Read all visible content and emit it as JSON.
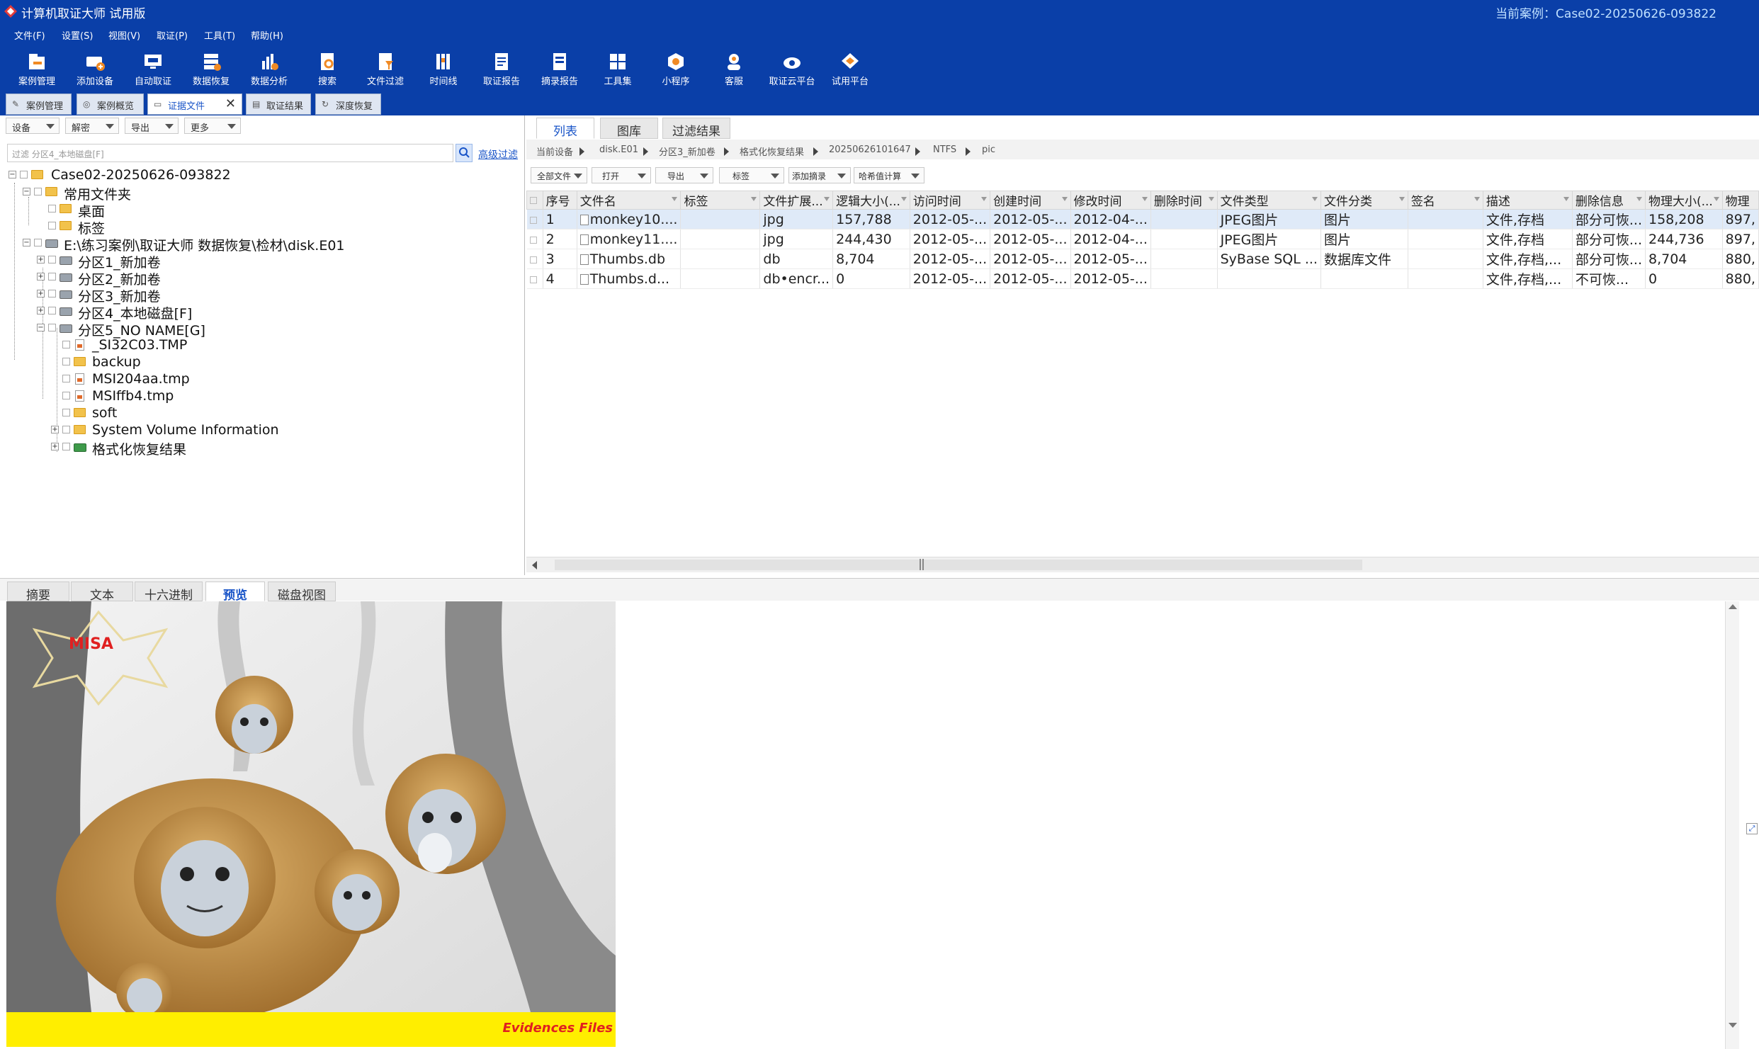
{
  "titlebar": {
    "app_title": "计算机取证大师 试用版",
    "current_case": "当前案例：Case02-20250626-093822"
  },
  "menu": [
    "文件(F)",
    "设置(S)",
    "视图(V)",
    "取证(P)",
    "工具(T)",
    "帮助(H)"
  ],
  "toolbar": [
    "案例管理",
    "添加设备",
    "自动取证",
    "数据恢复",
    "数据分析",
    "搜索",
    "文件过滤",
    "时间线",
    "取证报告",
    "摘录报告",
    "工具集",
    "小程序",
    "客服",
    "取证云平台",
    "试用平台"
  ],
  "doc_tabs": [
    "案例管理",
    "案例概览",
    "证据文件",
    "取证结果",
    "深度恢复"
  ],
  "left": {
    "buttons": [
      "设备",
      "解密",
      "导出",
      "更多"
    ],
    "filter_placeholder": "过滤 分区4_本地磁盘[F]",
    "advanced_filter": "高级过滤",
    "tree": {
      "case": "Case02-20250626-093822",
      "common": "常用文件夹",
      "desktop": "桌面",
      "tags": "标签",
      "evidence": "E:\\练习案例\\取证大师 数据恢复\\检材\\disk.E01",
      "p1": "分区1_新加卷",
      "p2": "分区2_新加卷",
      "p3": "分区3_新加卷",
      "p4": "分区4_本地磁盘[F]",
      "p5": "分区5_NO NAME[G]",
      "f1": "_SI32C03.TMP",
      "f2": "backup",
      "f3": "MSI204aa.tmp",
      "f4": "MSIffb4.tmp",
      "f5": "soft",
      "f6": "System Volume Information",
      "f7": "格式化恢复结果"
    }
  },
  "right": {
    "view_tabs": [
      "列表",
      "图库",
      "过滤结果"
    ],
    "breadcrumb": [
      "当前设备",
      "disk.E01",
      "分区3_新加卷",
      "格式化恢复结果",
      "20250626101647",
      "NTFS",
      "pic"
    ],
    "actions": [
      "全部文件",
      "打开",
      "导出",
      "标签",
      "添加摘录",
      "哈希值计算"
    ],
    "columns": [
      "序号",
      "文件名",
      "标签",
      "文件扩展...",
      "逻辑大小(...",
      "访问时间",
      "创建时间",
      "修改时间",
      "删除时间",
      "文件类型",
      "文件分类",
      "签名",
      "描述",
      "删除信息",
      "物理大小(...",
      "物理"
    ],
    "rows": [
      {
        "idx": "1",
        "name": "monkey10....",
        "tag": "",
        "ext": "jpg",
        "size": "157,788",
        "atime": "2012-05-...",
        "ctime": "2012-05-...",
        "mtime": "2012-04-...",
        "dtime": "",
        "type": "JPEG图片",
        "cat": "图片",
        "sig": "",
        "desc": "文件,存档",
        "del": "部分可恢...",
        "psize": "158,208",
        "phys": "897,"
      },
      {
        "idx": "2",
        "name": "monkey11....",
        "tag": "",
        "ext": "jpg",
        "size": "244,430",
        "atime": "2012-05-...",
        "ctime": "2012-05-...",
        "mtime": "2012-04-...",
        "dtime": "",
        "type": "JPEG图片",
        "cat": "图片",
        "sig": "",
        "desc": "文件,存档",
        "del": "部分可恢...",
        "psize": "244,736",
        "phys": "897,"
      },
      {
        "idx": "3",
        "name": "Thumbs.db",
        "tag": "",
        "ext": "db",
        "size": "8,704",
        "atime": "2012-05-...",
        "ctime": "2012-05-...",
        "mtime": "2012-05-...",
        "dtime": "",
        "type": "SyBase SQL ...",
        "cat": "数据库文件",
        "sig": "",
        "desc": "文件,存档,...",
        "del": "部分可恢...",
        "psize": "8,704",
        "phys": "880,"
      },
      {
        "idx": "4",
        "name": "Thumbs.d...",
        "tag": "",
        "ext": "db•encr...",
        "size": "0",
        "atime": "2012-05-...",
        "ctime": "2012-05-...",
        "mtime": "2012-05-...",
        "dtime": "",
        "type": "",
        "cat": "",
        "sig": "",
        "desc": "文件,存档,...",
        "del": "不可恢...",
        "psize": "0",
        "phys": "880,"
      }
    ]
  },
  "bottom_tabs": [
    "摘要",
    "文本",
    "十六进制",
    "预览",
    "磁盘视图"
  ],
  "preview": {
    "watermark": "MISA",
    "footer": "Evidences  Files"
  },
  "colors": {
    "brand_blue": "#0a3fa8",
    "link_blue": "#1a55c8",
    "selected_row": "#dfeaf8",
    "footer_yellow": "#ffee00"
  }
}
